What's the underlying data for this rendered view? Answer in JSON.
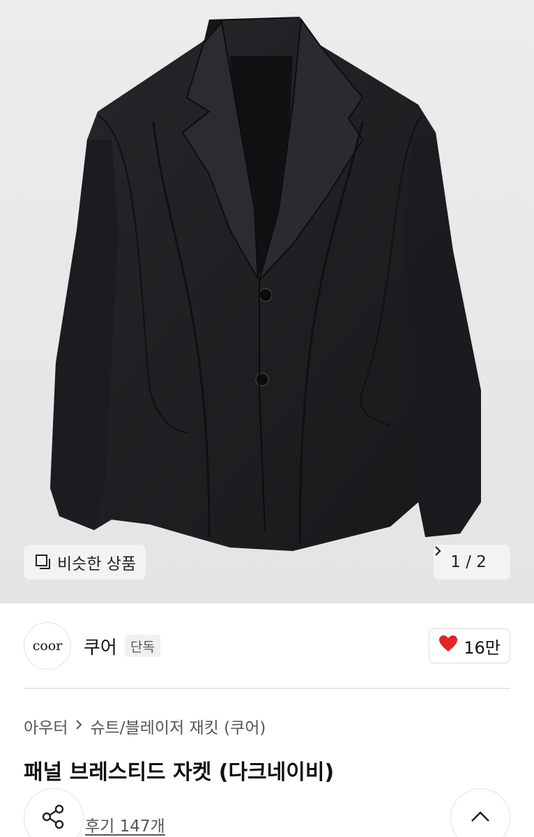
{
  "hero": {
    "image_subject": "dark navy panel breasted jacket",
    "similar_label": "비슷한 상품",
    "pager_text": "1 / 2"
  },
  "brand": {
    "logo_text": "coor",
    "name": "쿠어",
    "badge": "단독",
    "likes": "16만"
  },
  "breadcrumb": [
    "아우터",
    "슈트/블레이저 재킷 (쿠어)"
  ],
  "product": {
    "title": "패널 브레스티드 자켓 (다크네이비)",
    "reviews": "후기 147개"
  },
  "colors": {
    "heart": "#e0242a",
    "hero_bg": "#e9e9e9",
    "jacket": "#1e1f22"
  }
}
